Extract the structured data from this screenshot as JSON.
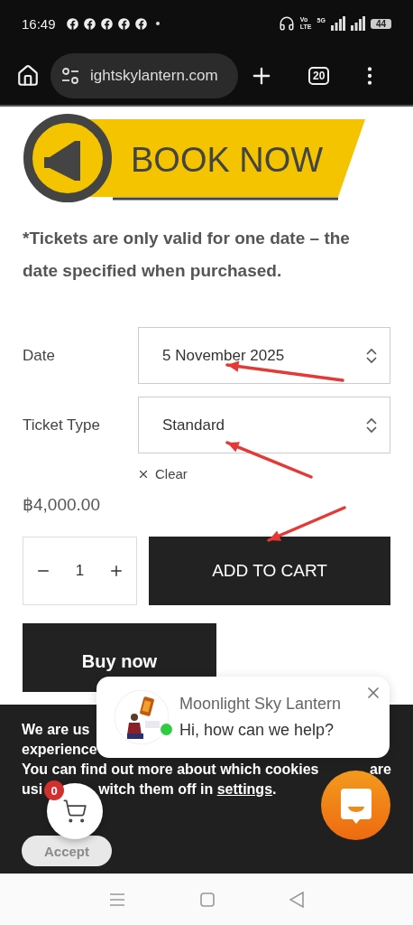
{
  "status_bar": {
    "time": "16:49",
    "volte": [
      "Vo",
      "LTE"
    ],
    "network": "5G",
    "battery": "44"
  },
  "browser": {
    "url": "ightskylantern.com",
    "tab_count": "20"
  },
  "banner": {
    "text": "BOOK NOW"
  },
  "notice": "*Tickets are only valid for one date – the date specified when purchased.",
  "fields": [
    {
      "label": "Date",
      "value": "5 November 2025"
    },
    {
      "label": "Ticket Type",
      "value": "Standard"
    }
  ],
  "clear": "Clear",
  "price": "฿4,000.00",
  "quantity": "1",
  "add_to_cart": "ADD TO CART",
  "buy_now": "Buy now",
  "cookie_banner": {
    "line_1": "We are us",
    "line_2": "experience",
    "line_3": "You can find out more about which cookies",
    "line_3_end": "are",
    "line_4_start": "usi",
    "line_4": "witch them off in",
    "link": "settings",
    "line_4_end": ".",
    "accept": "Accept"
  },
  "chat_popup": {
    "title": "Moonlight Sky Lantern",
    "message": "Hi, how can we help?",
    "online": true
  },
  "cart": {
    "count": "0"
  }
}
